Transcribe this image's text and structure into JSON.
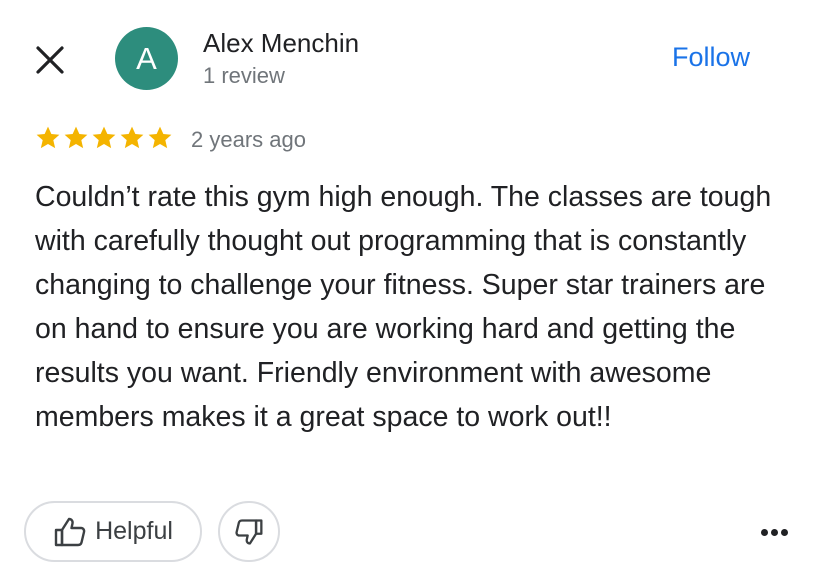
{
  "reviewer": {
    "initial": "A",
    "name": "Alex Menchin",
    "review_count": "1 review",
    "avatar_color": "#2d8d7d"
  },
  "follow": {
    "label": "Follow",
    "color": "#1a73e8"
  },
  "rating": {
    "stars": 5,
    "out_of": 5,
    "star_color": "#f4b400"
  },
  "time_ago": "2 years ago",
  "review_text": "Couldn’t rate this gym high enough. The classes are tough with carefully thought out programming that is constantly changing to challenge your fitness. Super star trainers are on hand to ensure you are working hard and getting the results you want. Friendly environment with awesome members makes it a great space to work out!!",
  "actions": {
    "helpful_label": "Helpful",
    "helpful_icon": "thumbs-up-icon",
    "dislike_icon": "thumbs-down-icon",
    "close_icon": "close-icon",
    "more_icon": "more-horizontal-icon"
  }
}
